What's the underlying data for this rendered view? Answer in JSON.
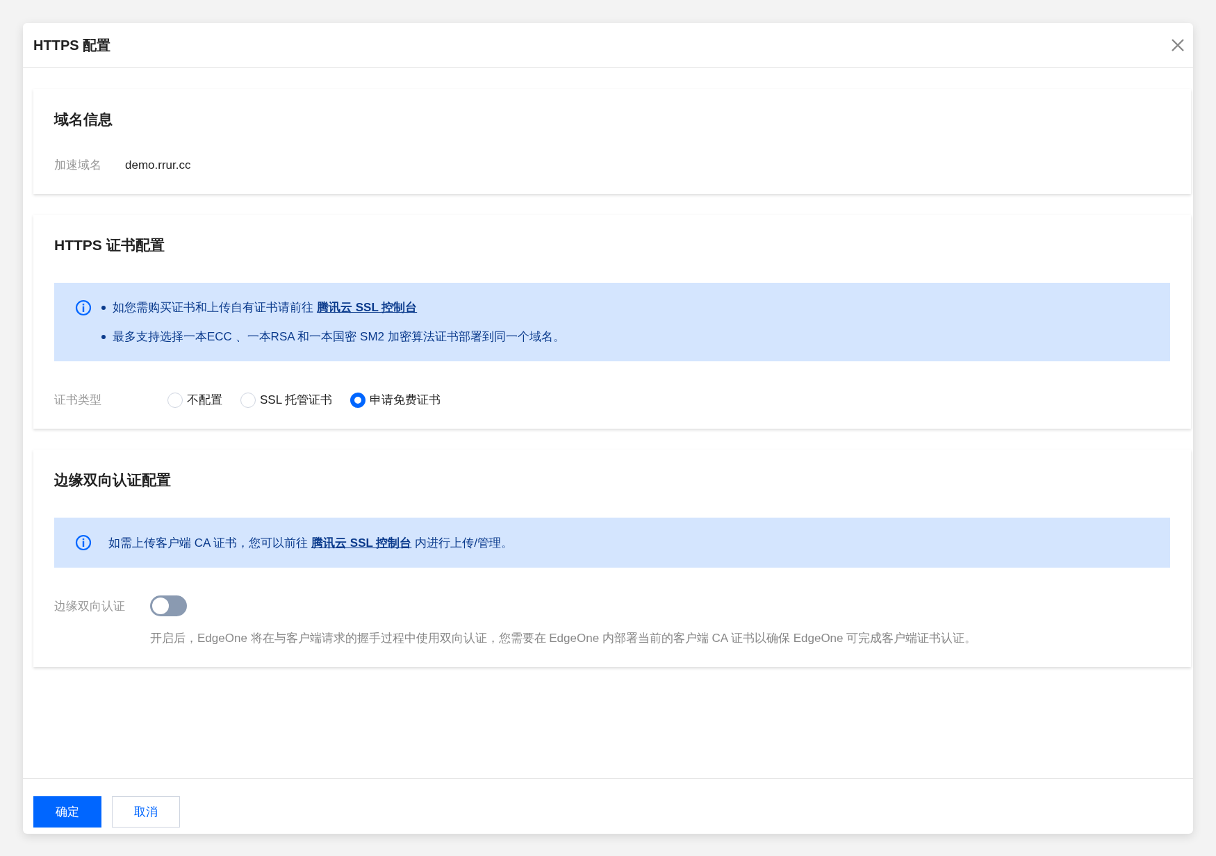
{
  "dialog": {
    "title": "HTTPS 配置"
  },
  "domain_section": {
    "title": "域名信息",
    "label": "加速域名",
    "value": "demo.rrur.cc"
  },
  "https_section": {
    "title": "HTTPS 证书配置",
    "notice": [
      {
        "text": "如您需购买证书和上传自有证书请前往",
        "link": "腾讯云 SSL 控制台"
      },
      {
        "text": "最多支持选择一本ECC 、一本RSA 和一本国密 SM2 加密算法证书部署到同一个域名。"
      }
    ],
    "cert_type": {
      "label": "证书类型",
      "options": [
        {
          "label": "不配置",
          "selected": false
        },
        {
          "label": "SSL 托管证书",
          "selected": false
        },
        {
          "label": "申请免费证书",
          "selected": true
        }
      ]
    }
  },
  "mtls_section": {
    "title": "边缘双向认证配置",
    "notice": {
      "text": "如需上传客户端 CA 证书，您可以前往",
      "link": "腾讯云 SSL 控制台",
      "after": "内进行上传/管理。"
    },
    "toggle": {
      "label": "边缘双向认证",
      "on": false
    },
    "description": "开启后，EdgeOne 将在与客户端请求的握手过程中使用双向认证，您需要在 EdgeOne 内部署当前的客户端 CA 证书以确保 EdgeOne 可完成客户端证书认证。"
  },
  "footer": {
    "buttons": [
      {
        "label": "确定",
        "kind": "primary"
      },
      {
        "label": "取消",
        "kind": "secondary"
      }
    ]
  }
}
